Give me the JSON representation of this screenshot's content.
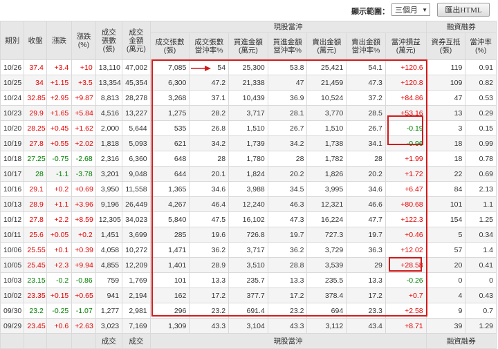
{
  "toolbar": {
    "range_label": "顯示範圍：",
    "range_value": "三個月",
    "export_label": "匯出HTML"
  },
  "groups": {
    "day_trade": "現股當沖",
    "margin": "融資融券"
  },
  "columns": {
    "date": "期別",
    "close": "收盤",
    "change": "漲跌",
    "change_pct": "漲跌\n(%)",
    "vol": "成交\n張數\n(張)",
    "amt": "成交\n金額\n(萬元)",
    "dt_vol": "成交張數\n(張)",
    "dt_vol_pct": "成交張數\n當沖率%",
    "buy_amt": "買進金額\n(萬元)",
    "buy_pct": "買進金額\n當沖率%",
    "sell_amt": "賣出金額\n(萬元)",
    "sell_pct": "賣出金額\n當沖率%",
    "pnl": "當沖損益\n(萬元)",
    "offset": "資券互抵\n(張)",
    "offset_rate": "當沖率\n(%)"
  },
  "rows": [
    [
      "10/26",
      "37.4",
      "+3.4",
      "+10",
      "13,110",
      "47,002",
      "7,085",
      "54",
      "25,300",
      "53.8",
      "25,421",
      "54.1",
      "+120.6",
      "119",
      "0.91"
    ],
    [
      "10/25",
      "34",
      "+1.15",
      "+3.5",
      "13,354",
      "45,354",
      "6,300",
      "47.2",
      "21,338",
      "47",
      "21,459",
      "47.3",
      "+120.8",
      "109",
      "0.82"
    ],
    [
      "10/24",
      "32.85",
      "+2.95",
      "+9.87",
      "8,813",
      "28,278",
      "3,268",
      "37.1",
      "10,439",
      "36.9",
      "10,524",
      "37.2",
      "+84.86",
      "47",
      "0.53"
    ],
    [
      "10/23",
      "29.9",
      "+1.65",
      "+5.84",
      "4,516",
      "13,227",
      "1,275",
      "28.2",
      "3,717",
      "28.1",
      "3,770",
      "28.5",
      "+53.16",
      "13",
      "0.29"
    ],
    [
      "10/20",
      "28.25",
      "+0.45",
      "+1.62",
      "2,000",
      "5,644",
      "535",
      "26.8",
      "1,510",
      "26.7",
      "1,510",
      "26.7",
      "-0.19",
      "3",
      "0.15"
    ],
    [
      "10/19",
      "27.8",
      "+0.55",
      "+2.02",
      "1,818",
      "5,093",
      "621",
      "34.2",
      "1,739",
      "34.2",
      "1,738",
      "34.1",
      "-0.96",
      "18",
      "0.99"
    ],
    [
      "10/18",
      "27.25",
      "-0.75",
      "-2.68",
      "2,316",
      "6,360",
      "648",
      "28",
      "1,780",
      "28",
      "1,782",
      "28",
      "+1.99",
      "18",
      "0.78"
    ],
    [
      "10/17",
      "28",
      "-1.1",
      "-3.78",
      "3,201",
      "9,048",
      "644",
      "20.1",
      "1,824",
      "20.2",
      "1,826",
      "20.2",
      "+1.72",
      "22",
      "0.69"
    ],
    [
      "10/16",
      "29.1",
      "+0.2",
      "+0.69",
      "3,950",
      "11,558",
      "1,365",
      "34.6",
      "3,988",
      "34.5",
      "3,995",
      "34.6",
      "+6.47",
      "84",
      "2.13"
    ],
    [
      "10/13",
      "28.9",
      "+1.1",
      "+3.96",
      "9,196",
      "26,449",
      "4,267",
      "46.4",
      "12,240",
      "46.3",
      "12,321",
      "46.6",
      "+80.68",
      "101",
      "1.1"
    ],
    [
      "10/12",
      "27.8",
      "+2.2",
      "+8.59",
      "12,305",
      "34,023",
      "5,840",
      "47.5",
      "16,102",
      "47.3",
      "16,224",
      "47.7",
      "+122.3",
      "154",
      "1.25"
    ],
    [
      "10/11",
      "25.6",
      "+0.05",
      "+0.2",
      "1,451",
      "3,699",
      "285",
      "19.6",
      "726.8",
      "19.7",
      "727.3",
      "19.7",
      "+0.46",
      "5",
      "0.34"
    ],
    [
      "10/06",
      "25.55",
      "+0.1",
      "+0.39",
      "4,058",
      "10,272",
      "1,471",
      "36.2",
      "3,717",
      "36.2",
      "3,729",
      "36.3",
      "+12.02",
      "57",
      "1.4"
    ],
    [
      "10/05",
      "25.45",
      "+2.3",
      "+9.94",
      "4,855",
      "12,209",
      "1,401",
      "28.9",
      "3,510",
      "28.8",
      "3,539",
      "29",
      "+28.58",
      "20",
      "0.41"
    ],
    [
      "10/03",
      "23.15",
      "-0.2",
      "-0.86",
      "759",
      "1,769",
      "101",
      "13.3",
      "235.7",
      "13.3",
      "235.5",
      "13.3",
      "-0.26",
      "0",
      "0"
    ],
    [
      "10/02",
      "23.35",
      "+0.15",
      "+0.65",
      "941",
      "2,194",
      "162",
      "17.2",
      "377.7",
      "17.2",
      "378.4",
      "17.2",
      "+0.7",
      "4",
      "0.43"
    ],
    [
      "09/30",
      "23.2",
      "-0.25",
      "-1.07",
      "1,277",
      "2,981",
      "296",
      "23.2",
      "691.4",
      "23.2",
      "694",
      "23.3",
      "+2.58",
      "9",
      "0.7"
    ],
    [
      "09/29",
      "23.45",
      "+0.6",
      "+2.63",
      "3,023",
      "7,169",
      "1,309",
      "43.3",
      "3,104",
      "43.3",
      "3,112",
      "43.4",
      "+8.71",
      "39",
      "1.29"
    ]
  ],
  "footer": {
    "col_vol": "成交",
    "col_amt": "成交",
    "day_trade": "現股當沖",
    "margin": "融資融券"
  },
  "colors": {
    "up": "#e60000",
    "down": "#008000",
    "highlight": "#d21a1a",
    "header_bg": "#e7e7e7"
  }
}
